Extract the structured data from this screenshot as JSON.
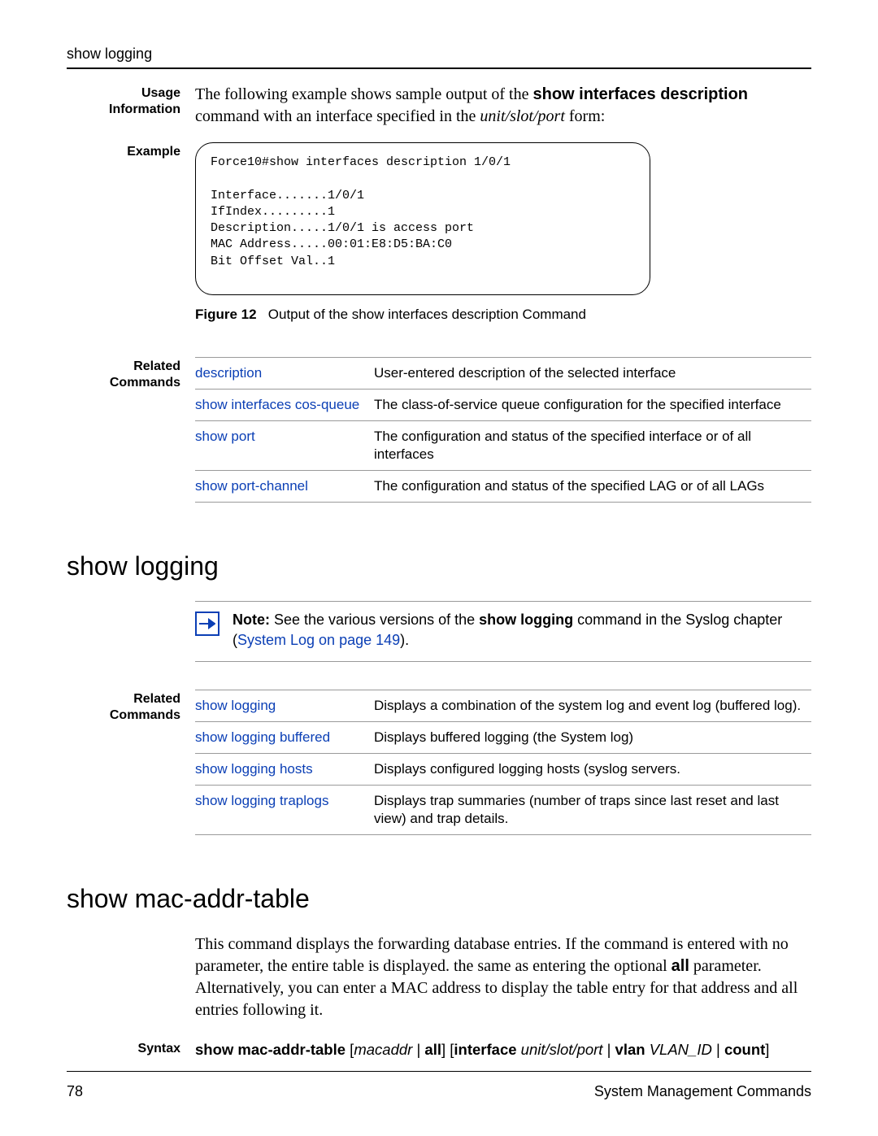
{
  "runningHead": "show logging",
  "usage": {
    "label": "Usage\nInformation",
    "text1": "The following example shows sample output of the ",
    "cmd": "show interfaces description",
    "text2": " command with an interface specified in the ",
    "param": "unit/slot/port",
    "text3": " form:"
  },
  "example": {
    "label": "Example",
    "code": "Force10#show interfaces description 1/0/1\n\nInterface.......1/0/1\nIfIndex.........1\nDescription.....1/0/1 is access port\nMAC Address.....00:01:E8:D5:BA:C0\nBit Offset Val..1",
    "figLabel": "Figure 12",
    "figText": "Output of the show interfaces description Command"
  },
  "related1": {
    "label": "Related\nCommands",
    "rows": [
      {
        "cmd": "description",
        "desc": "User-entered description of the selected interface"
      },
      {
        "cmd": "show interfaces cos-queue",
        "desc": "The class-of-service queue configuration for the specified interface"
      },
      {
        "cmd": "show port",
        "desc": "The configuration and status of the specified interface or of all interfaces"
      },
      {
        "cmd": "show port-channel",
        "desc": "The configuration and status of the specified LAG or of all LAGs"
      }
    ]
  },
  "section_show_logging": {
    "title": "show logging",
    "noteLabel": "Note:",
    "noteText1": " See the various versions of the ",
    "noteCmd": "show logging",
    "noteText2": " command in the Syslog chapter (",
    "noteLink": "System Log on page 149",
    "noteText3": ")."
  },
  "related2": {
    "label": "Related\nCommands",
    "rows": [
      {
        "cmd": "show logging",
        "desc": "Displays a combination of the system log and event log (buffered log)."
      },
      {
        "cmd": "show logging buffered",
        "desc": "Displays buffered logging (the System log)"
      },
      {
        "cmd": "show logging hosts",
        "desc": "Displays configured logging hosts (syslog servers."
      },
      {
        "cmd": "show logging traplogs",
        "desc": "Displays trap summaries (number of traps since last reset and last view) and trap details."
      }
    ]
  },
  "section_mac": {
    "title": "show mac-addr-table",
    "bodyA": "This command displays the forwarding database entries. If the command is entered with no parameter, the entire table is displayed. the same as entering the optional ",
    "bodyAllKw": "all",
    "bodyB": " parameter. Alternatively, you can enter a MAC address to display the table entry for that address and all entries following it.",
    "syntaxLabel": "Syntax",
    "syntax": {
      "s1": "show mac-addr-table",
      "s2": " [",
      "s3": "macaddr",
      "s4": " | ",
      "s5": "all",
      "s6": "] [",
      "s7": "interface",
      "s8": " ",
      "s9": "unit/slot/port",
      "s10": " | ",
      "s11": "vlan",
      "s12": " ",
      "s13": "VLAN_ID",
      "s14": " | ",
      "s15": "count",
      "s16": "]"
    }
  },
  "footer": {
    "pageNum": "78",
    "chapter": "System Management Commands"
  }
}
